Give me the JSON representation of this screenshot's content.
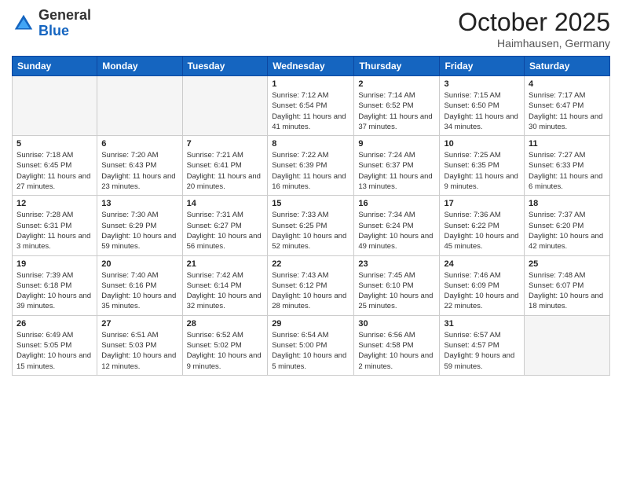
{
  "header": {
    "logo_general": "General",
    "logo_blue": "Blue",
    "month": "October 2025",
    "location": "Haimhausen, Germany"
  },
  "days_of_week": [
    "Sunday",
    "Monday",
    "Tuesday",
    "Wednesday",
    "Thursday",
    "Friday",
    "Saturday"
  ],
  "weeks": [
    [
      {
        "day": "",
        "info": ""
      },
      {
        "day": "",
        "info": ""
      },
      {
        "day": "",
        "info": ""
      },
      {
        "day": "1",
        "info": "Sunrise: 7:12 AM\nSunset: 6:54 PM\nDaylight: 11 hours and 41 minutes."
      },
      {
        "day": "2",
        "info": "Sunrise: 7:14 AM\nSunset: 6:52 PM\nDaylight: 11 hours and 37 minutes."
      },
      {
        "day": "3",
        "info": "Sunrise: 7:15 AM\nSunset: 6:50 PM\nDaylight: 11 hours and 34 minutes."
      },
      {
        "day": "4",
        "info": "Sunrise: 7:17 AM\nSunset: 6:47 PM\nDaylight: 11 hours and 30 minutes."
      }
    ],
    [
      {
        "day": "5",
        "info": "Sunrise: 7:18 AM\nSunset: 6:45 PM\nDaylight: 11 hours and 27 minutes."
      },
      {
        "day": "6",
        "info": "Sunrise: 7:20 AM\nSunset: 6:43 PM\nDaylight: 11 hours and 23 minutes."
      },
      {
        "day": "7",
        "info": "Sunrise: 7:21 AM\nSunset: 6:41 PM\nDaylight: 11 hours and 20 minutes."
      },
      {
        "day": "8",
        "info": "Sunrise: 7:22 AM\nSunset: 6:39 PM\nDaylight: 11 hours and 16 minutes."
      },
      {
        "day": "9",
        "info": "Sunrise: 7:24 AM\nSunset: 6:37 PM\nDaylight: 11 hours and 13 minutes."
      },
      {
        "day": "10",
        "info": "Sunrise: 7:25 AM\nSunset: 6:35 PM\nDaylight: 11 hours and 9 minutes."
      },
      {
        "day": "11",
        "info": "Sunrise: 7:27 AM\nSunset: 6:33 PM\nDaylight: 11 hours and 6 minutes."
      }
    ],
    [
      {
        "day": "12",
        "info": "Sunrise: 7:28 AM\nSunset: 6:31 PM\nDaylight: 11 hours and 3 minutes."
      },
      {
        "day": "13",
        "info": "Sunrise: 7:30 AM\nSunset: 6:29 PM\nDaylight: 10 hours and 59 minutes."
      },
      {
        "day": "14",
        "info": "Sunrise: 7:31 AM\nSunset: 6:27 PM\nDaylight: 10 hours and 56 minutes."
      },
      {
        "day": "15",
        "info": "Sunrise: 7:33 AM\nSunset: 6:25 PM\nDaylight: 10 hours and 52 minutes."
      },
      {
        "day": "16",
        "info": "Sunrise: 7:34 AM\nSunset: 6:24 PM\nDaylight: 10 hours and 49 minutes."
      },
      {
        "day": "17",
        "info": "Sunrise: 7:36 AM\nSunset: 6:22 PM\nDaylight: 10 hours and 45 minutes."
      },
      {
        "day": "18",
        "info": "Sunrise: 7:37 AM\nSunset: 6:20 PM\nDaylight: 10 hours and 42 minutes."
      }
    ],
    [
      {
        "day": "19",
        "info": "Sunrise: 7:39 AM\nSunset: 6:18 PM\nDaylight: 10 hours and 39 minutes."
      },
      {
        "day": "20",
        "info": "Sunrise: 7:40 AM\nSunset: 6:16 PM\nDaylight: 10 hours and 35 minutes."
      },
      {
        "day": "21",
        "info": "Sunrise: 7:42 AM\nSunset: 6:14 PM\nDaylight: 10 hours and 32 minutes."
      },
      {
        "day": "22",
        "info": "Sunrise: 7:43 AM\nSunset: 6:12 PM\nDaylight: 10 hours and 28 minutes."
      },
      {
        "day": "23",
        "info": "Sunrise: 7:45 AM\nSunset: 6:10 PM\nDaylight: 10 hours and 25 minutes."
      },
      {
        "day": "24",
        "info": "Sunrise: 7:46 AM\nSunset: 6:09 PM\nDaylight: 10 hours and 22 minutes."
      },
      {
        "day": "25",
        "info": "Sunrise: 7:48 AM\nSunset: 6:07 PM\nDaylight: 10 hours and 18 minutes."
      }
    ],
    [
      {
        "day": "26",
        "info": "Sunrise: 6:49 AM\nSunset: 5:05 PM\nDaylight: 10 hours and 15 minutes."
      },
      {
        "day": "27",
        "info": "Sunrise: 6:51 AM\nSunset: 5:03 PM\nDaylight: 10 hours and 12 minutes."
      },
      {
        "day": "28",
        "info": "Sunrise: 6:52 AM\nSunset: 5:02 PM\nDaylight: 10 hours and 9 minutes."
      },
      {
        "day": "29",
        "info": "Sunrise: 6:54 AM\nSunset: 5:00 PM\nDaylight: 10 hours and 5 minutes."
      },
      {
        "day": "30",
        "info": "Sunrise: 6:56 AM\nSunset: 4:58 PM\nDaylight: 10 hours and 2 minutes."
      },
      {
        "day": "31",
        "info": "Sunrise: 6:57 AM\nSunset: 4:57 PM\nDaylight: 9 hours and 59 minutes."
      },
      {
        "day": "",
        "info": ""
      }
    ]
  ]
}
